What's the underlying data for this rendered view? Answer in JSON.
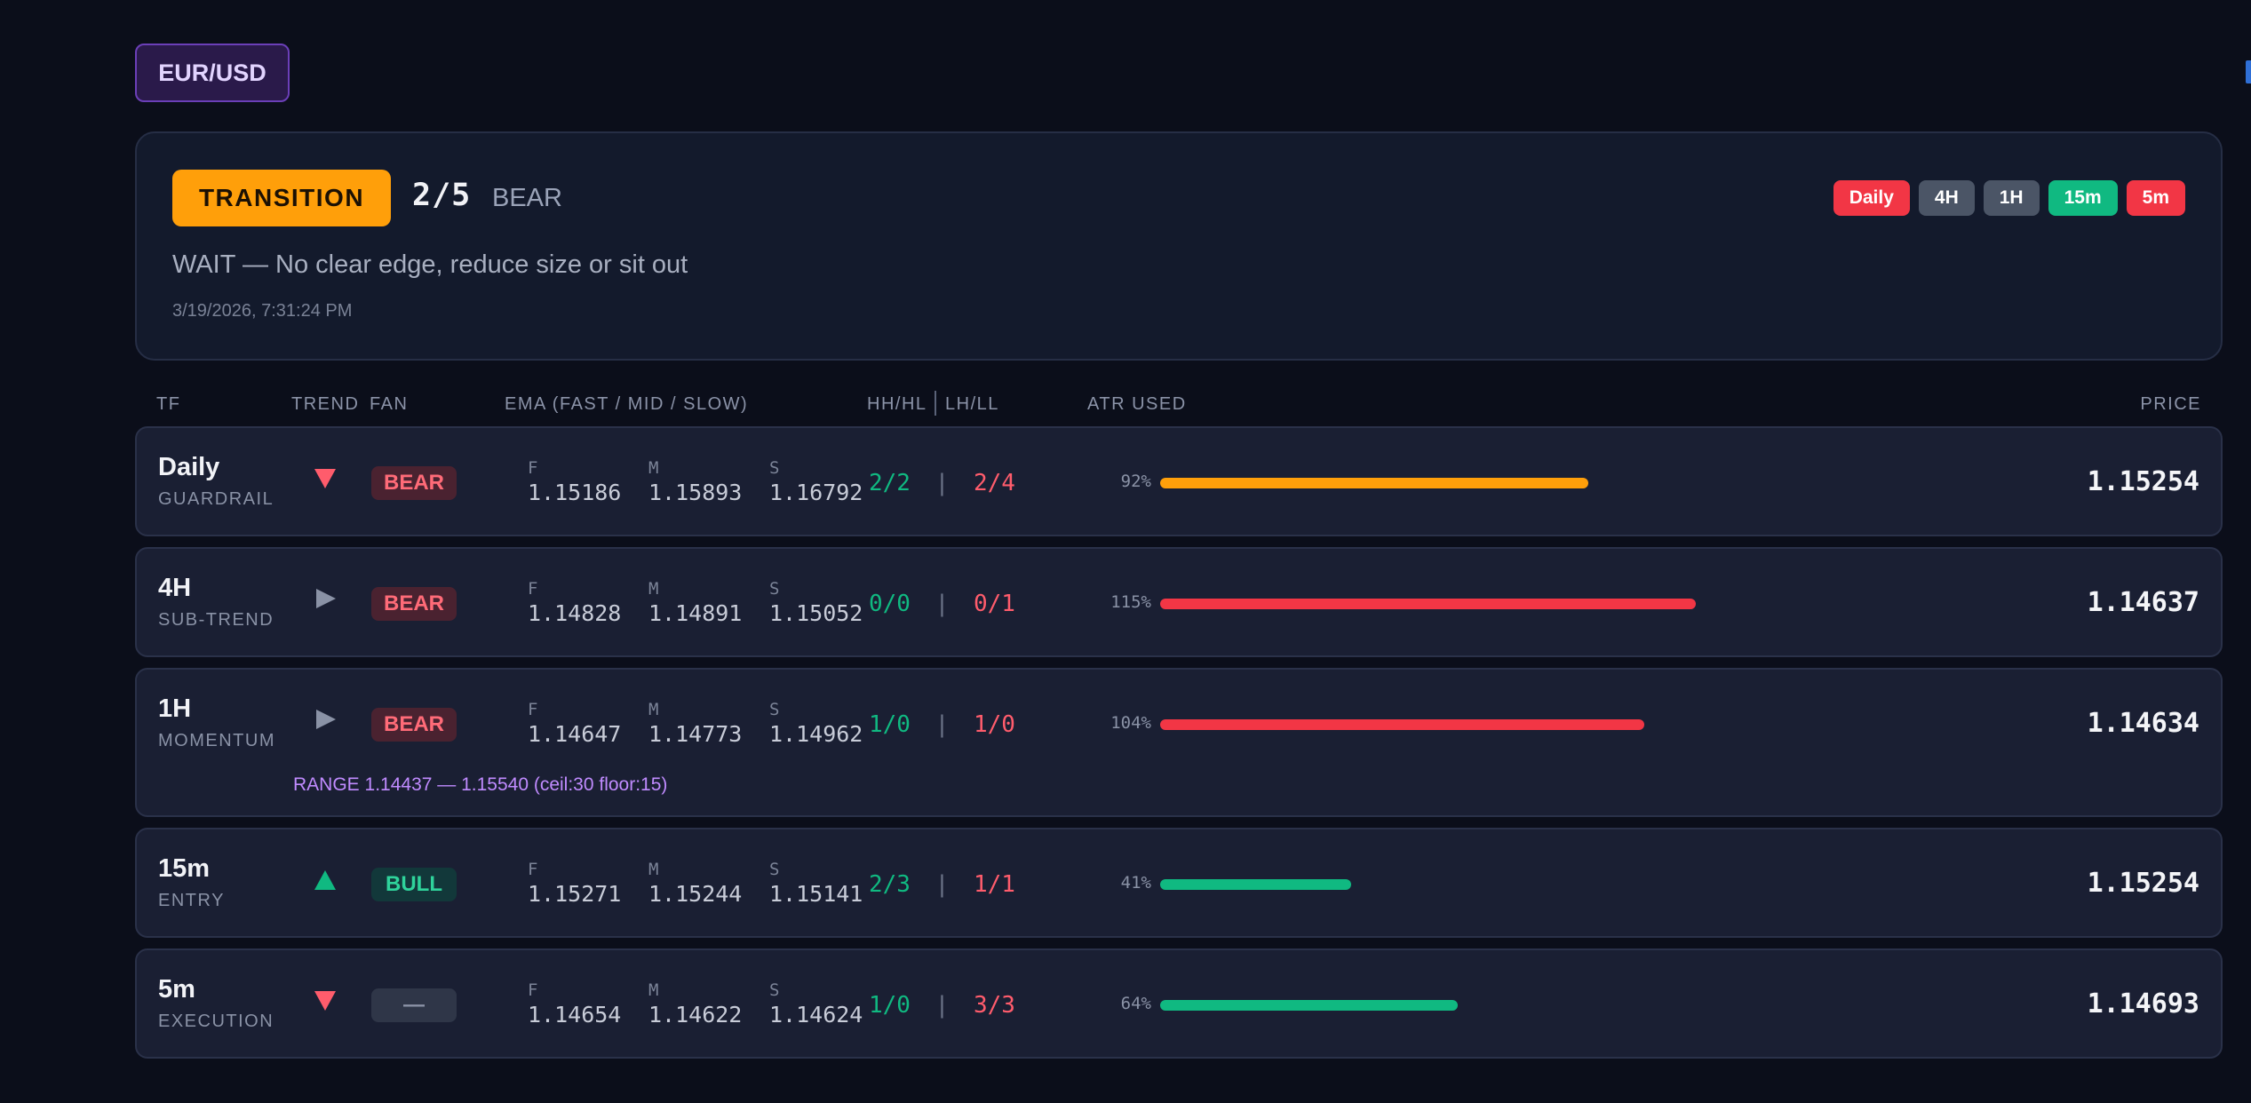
{
  "pair": "EUR/USD",
  "summary": {
    "state": "TRANSITION",
    "score": "2/5",
    "bias": "BEAR",
    "advice": "WAIT — No clear edge, reduce size or sit out",
    "timestamp": "3/19/2026, 7:31:24 PM",
    "chips": [
      {
        "label": "Daily",
        "color": "#f23645"
      },
      {
        "label": "4H",
        "color": "#4b5566"
      },
      {
        "label": "1H",
        "color": "#4b5566"
      },
      {
        "label": "15m",
        "color": "#10b981"
      },
      {
        "label": "5m",
        "color": "#f23645"
      }
    ]
  },
  "columns": {
    "tf": "TF",
    "trend": "TREND",
    "fan": "FAN",
    "ema": "EMA (FAST / MID / SLOW)",
    "hh": "HH/HL",
    "ll": "LH/LL",
    "atr": "ATR USED",
    "price": "PRICE"
  },
  "ema_labels": {
    "f": "F",
    "m": "M",
    "s": "S"
  },
  "colors": {
    "bull": "#10b981",
    "bear": "#ff5c6c",
    "neutral": "#8a92a6",
    "orange": "#ff9f0a",
    "red": "#f23645",
    "green": "#10b981"
  },
  "rows": [
    {
      "tf": "Daily",
      "role": "GUARDRAIL",
      "trend": "down-icon",
      "fan": "BEAR",
      "ema_f": "1.15186",
      "ema_m": "1.15893",
      "ema_s": "1.16792",
      "hh": "2/2",
      "ll": "2/4",
      "atr_text": "92%",
      "atr_level": 0.92,
      "atr_color": "#ff9f0a",
      "price": "1.15254"
    },
    {
      "tf": "4H",
      "role": "SUB-TREND",
      "trend": "right-icon",
      "fan": "BEAR",
      "ema_f": "1.14828",
      "ema_m": "1.14891",
      "ema_s": "1.15052",
      "hh": "0/0",
      "ll": "0/1",
      "atr_text": "115%",
      "atr_level": 1.15,
      "atr_color": "#f23645",
      "price": "1.14637"
    },
    {
      "tf": "1H",
      "role": "MOMENTUM",
      "trend": "right-icon",
      "fan": "BEAR",
      "ema_f": "1.14647",
      "ema_m": "1.14773",
      "ema_s": "1.14962",
      "hh": "1/0",
      "ll": "1/0",
      "atr_text": "104%",
      "atr_level": 1.04,
      "atr_color": "#f23645",
      "price": "1.14634",
      "range": "RANGE 1.14437 — 1.15540 (ceil:30 floor:15)"
    },
    {
      "tf": "15m",
      "role": "ENTRY",
      "trend": "up-icon",
      "fan": "BULL",
      "ema_f": "1.15271",
      "ema_m": "1.15244",
      "ema_s": "1.15141",
      "hh": "2/3",
      "ll": "1/1",
      "atr_text": "41%",
      "atr_level": 0.41,
      "atr_color": "#10b981",
      "price": "1.15254"
    },
    {
      "tf": "5m",
      "role": "EXECUTION",
      "trend": "down-icon",
      "fan": "—",
      "ema_f": "1.14654",
      "ema_m": "1.14622",
      "ema_s": "1.14624",
      "hh": "1/0",
      "ll": "3/3",
      "atr_text": "64%",
      "atr_level": 0.64,
      "atr_color": "#10b981",
      "price": "1.14693"
    }
  ]
}
